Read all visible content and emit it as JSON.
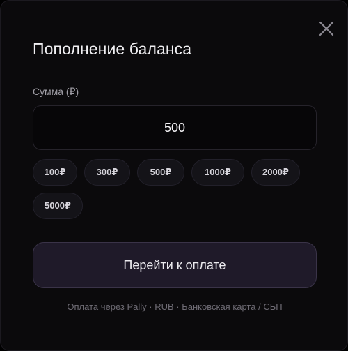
{
  "modal": {
    "title": "Пополнение баланса",
    "close_icon": "close-icon"
  },
  "amount": {
    "label": "Сумма (₽)",
    "value": "500"
  },
  "presets": [
    {
      "label": "100₽"
    },
    {
      "label": "300₽"
    },
    {
      "label": "500₽"
    },
    {
      "label": "1000₽"
    },
    {
      "label": "2000₽"
    },
    {
      "label": "5000₽"
    }
  ],
  "pay_button": {
    "label": "Перейти к оплате"
  },
  "footer": {
    "note": "Оплата через Pally · RUB · Банковская карта / СБП"
  },
  "colors": {
    "background": "#0b0a0c",
    "accent_button": "#1f1a29",
    "text": "#f1f0f3"
  }
}
